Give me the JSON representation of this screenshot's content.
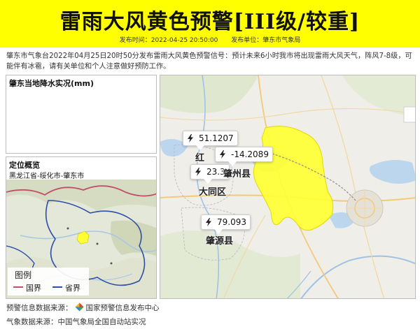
{
  "banner": {
    "title": "雷雨大风黄色预警[III级/较重]",
    "publish_time_label": "发布时间：2022-04-25 20:50:00",
    "publisher_label": "发布单位：肇东市气象局",
    "color": "#ffff00"
  },
  "description": "肇东市气象台2022年04月25日20时50分发布雷雨大风黄色预警信号：预计未来6小时我市将出现雷雨大风天气，阵风7-8级，可能伴有冰雹，请有关单位和个人注意做好预防工作。",
  "precip_panel": {
    "title": "肇东当地降水实况(mm)"
  },
  "location_panel": {
    "title": "定位概览",
    "path": "黑龙江省-绥化市-肇东市",
    "legend": {
      "title": "图例",
      "items": [
        {
          "label": "国界",
          "color": "#c0506a"
        },
        {
          "label": "省界",
          "color": "#2c4fa8"
        }
      ]
    }
  },
  "main_map": {
    "warning_area_color": "#ffff33",
    "callouts": [
      {
        "value": "51.1207",
        "icon": "lightning-icon"
      },
      {
        "value": "-14.2089",
        "icon": "lightning-icon"
      },
      {
        "value": "23.3",
        "icon": "lightning-icon"
      },
      {
        "value": "79.093",
        "icon": "lightning-icon"
      }
    ],
    "labels": {
      "hongqi": "红",
      "zhaozhou": "肇州县",
      "datong": "大同区",
      "zhaoyuan": "肇源县"
    }
  },
  "footer": {
    "warning_source_label": "预警信息数据来源：",
    "warning_source_name": "国家预警信息发布中心",
    "weather_source_label": "气象数据来源：",
    "weather_source_name": "中国气象局全国自动站实况"
  }
}
